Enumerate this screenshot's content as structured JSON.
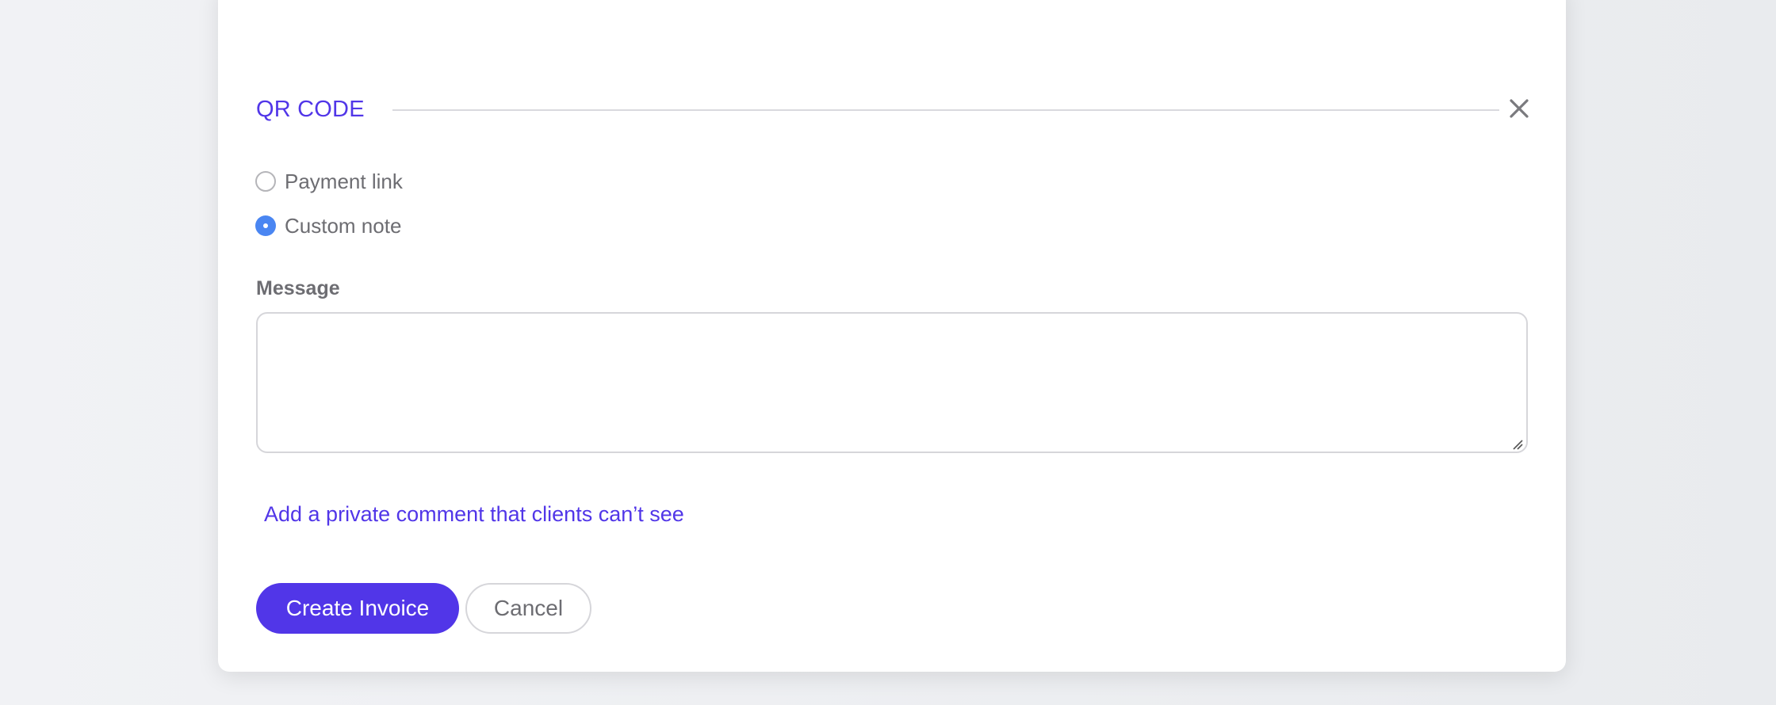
{
  "qr_section": {
    "title": "QR CODE",
    "close_icon": "close-icon"
  },
  "qr_options": [
    {
      "label": "Payment link",
      "checked": false
    },
    {
      "label": "Custom note",
      "checked": true
    }
  ],
  "message": {
    "label": "Message",
    "value": ""
  },
  "private_comment_link": "Add a private comment that clients can’t see",
  "actions": {
    "create_label": "Create Invoice",
    "cancel_label": "Cancel"
  },
  "colors": {
    "accent": "#5136e8",
    "radio_checked": "#4a86f2"
  }
}
